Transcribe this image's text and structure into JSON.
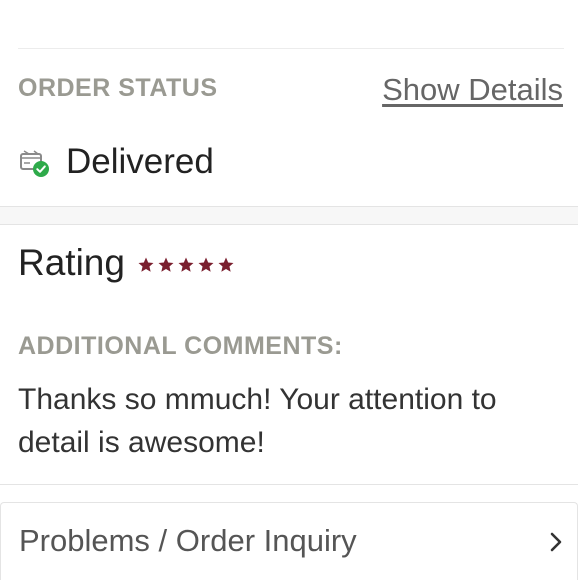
{
  "order_status": {
    "heading": "ORDER STATUS",
    "show_details_label": "Show Details",
    "status": "Delivered",
    "status_icon": "delivered-box-check-icon",
    "status_icon_color": "#2eaa4a"
  },
  "rating": {
    "label": "Rating",
    "stars": 5,
    "max_stars": 5,
    "star_color": "#7a1f2e"
  },
  "comments": {
    "heading": "ADDITIONAL COMMENTS:",
    "text": "Thanks so mmuch! Your attention to detail is awesome!"
  },
  "inquiry": {
    "label": "Problems / Order Inquiry",
    "icon": "chevron-right-icon"
  }
}
